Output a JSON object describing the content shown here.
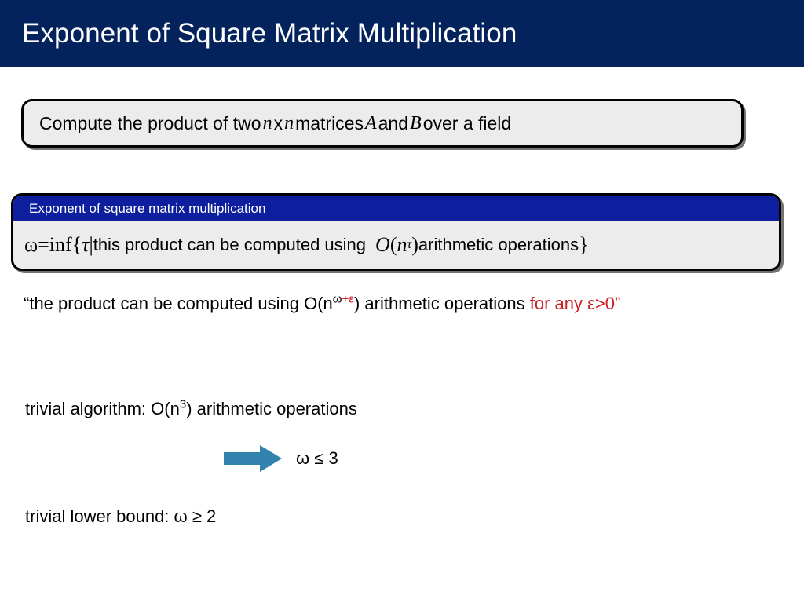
{
  "slide": {
    "title": "Exponent of Square Matrix Multiplication",
    "title_bar_color": "#04235c",
    "background_color": "#ffffff"
  },
  "problem_box": {
    "label": "problem-statement",
    "fill_color": "#ececec",
    "border_color": "#000000",
    "parts": {
      "lead": "Compute the product of two ",
      "var_n1": "n",
      "times": " x ",
      "var_n2": "n",
      "mid": " matrices ",
      "var_A": "A",
      "and": " and ",
      "var_B": "B",
      "tail": " over a field"
    },
    "full_text": "Compute the product of two n x n matrices A and B over a field"
  },
  "definition_box": {
    "header": "Exponent of square matrix multiplication",
    "header_color": "#0d1f9e",
    "fill_color": "#ececec",
    "formula": {
      "omega": "ω",
      "equals": " = ",
      "inf": "inf",
      "brace_open": " { ",
      "tau": "τ",
      "bar": " | ",
      "text1": "this product can be computed using",
      "bigO": "O",
      "paren_open": "(",
      "base_n": "n",
      "exp_tau": "τ",
      "paren_close": ")",
      "text2": " arithmetic operations ",
      "brace_close": "}"
    },
    "full_text": "ω = inf { τ | this product can be computed using O(nᵀ) arithmetic operations }"
  },
  "quote_line": {
    "open_quote": "“",
    "text1": "the product can be computed using O(n",
    "sup_omega": "ω",
    "sup_plus_eps": "+ε",
    "text2": ") arithmetic operations ",
    "red_text": "for any ε>0",
    "close_quote": "”",
    "red_color": "#cc2128"
  },
  "trivial_algorithm": {
    "text1": "trivial algorithm: O(n",
    "sup": "3",
    "text2": ") arithmetic operations"
  },
  "arrow": {
    "icon": "right-arrow-icon",
    "color": "#3183ad",
    "conclusion": "ω ≤ 3"
  },
  "lower_bound": {
    "text": "trivial lower bound: ω ≥ 2"
  }
}
